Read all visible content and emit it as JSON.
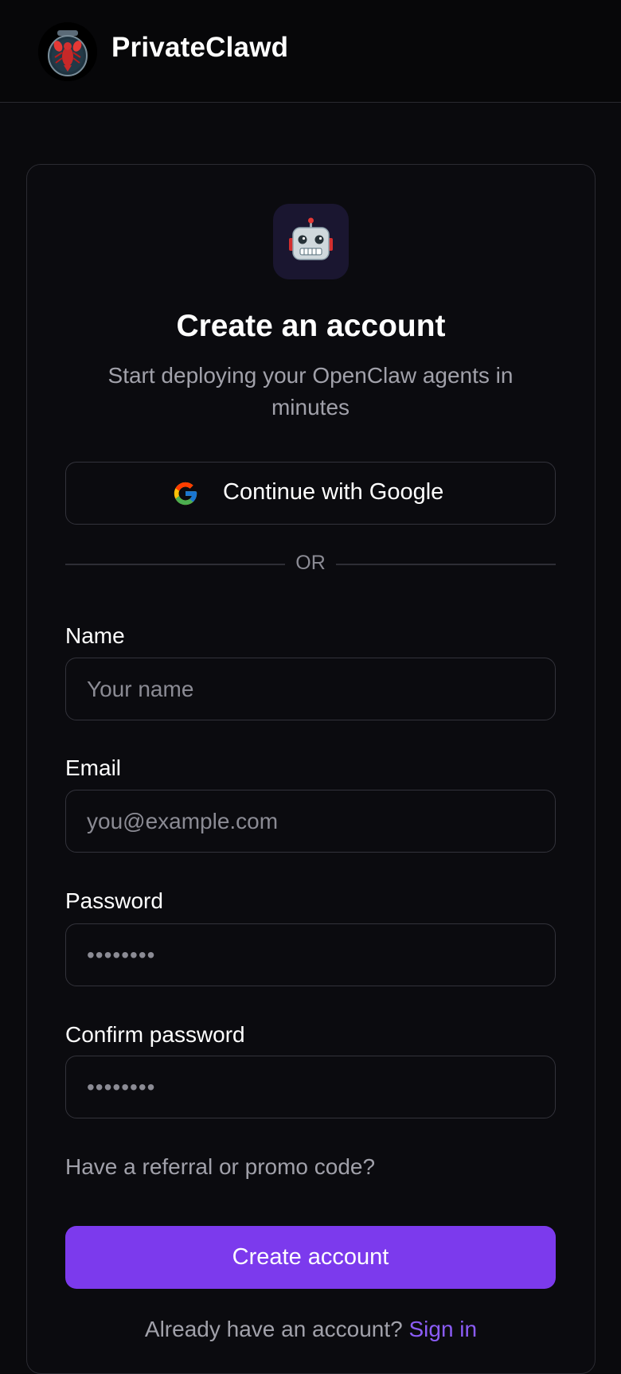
{
  "header": {
    "brand": "PrivateClawd",
    "logo_icon": "lobster-jar-icon"
  },
  "card": {
    "hero_icon": "robot-icon",
    "title": "Create an account",
    "subtitle": "Start deploying your OpenClaw agents in minutes",
    "google_button_label": "Continue with Google",
    "divider_text": "OR",
    "fields": {
      "name": {
        "label": "Name",
        "placeholder": "Your name"
      },
      "email": {
        "label": "Email",
        "placeholder": "you@example.com"
      },
      "password": {
        "label": "Password",
        "placeholder": "••••••••"
      },
      "confirm_password": {
        "label": "Confirm password",
        "placeholder": "••••••••"
      }
    },
    "promo_link": "Have a referral or promo code?",
    "create_button_label": "Create account",
    "signin_prompt": "Already have an account?",
    "signin_link": "Sign in"
  },
  "colors": {
    "background": "#0a0a0d",
    "accent": "#7c3aed",
    "link": "#8b5cf6",
    "muted_text": "#a1a1aa"
  }
}
